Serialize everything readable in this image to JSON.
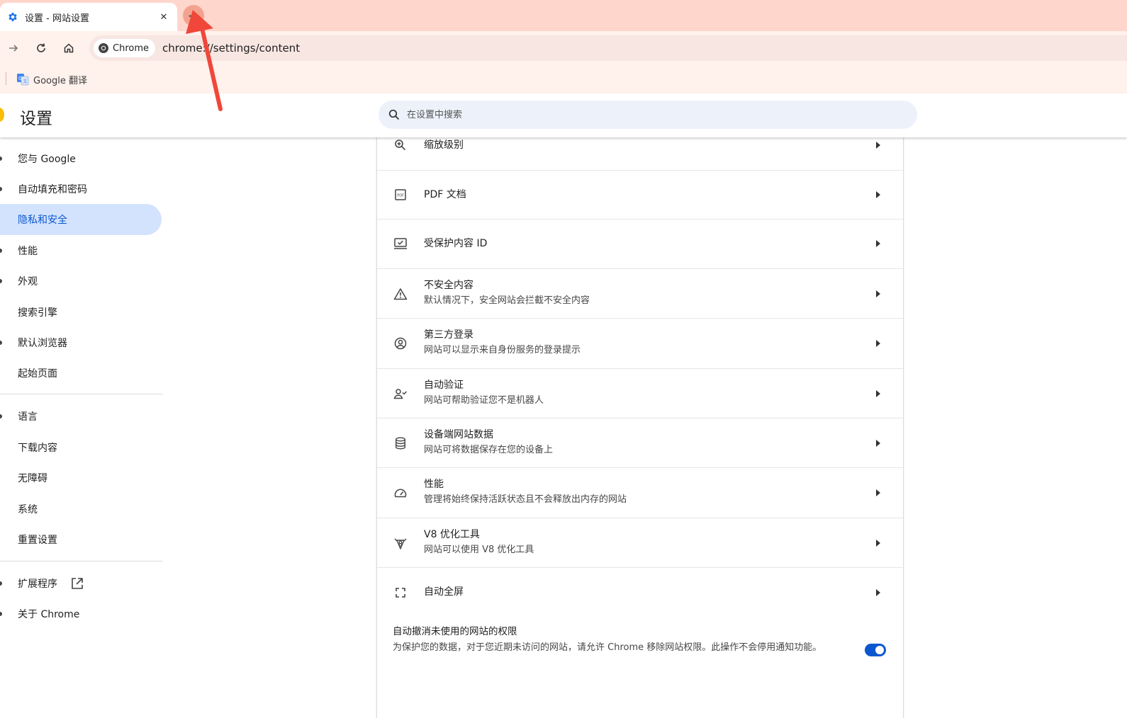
{
  "browser": {
    "tab": {
      "title": "设置 - 网站设置",
      "close": "✕"
    },
    "new_tab": "+",
    "omnibox": {
      "chip_label": "Chrome",
      "url": "chrome://settings/content"
    },
    "bookmarks": [
      {
        "label": "Google 翻译"
      }
    ]
  },
  "header": {
    "title": "设置",
    "search_placeholder": "在设置中搜索"
  },
  "sidebar": {
    "items": [
      {
        "label": "您与 Google",
        "active": false
      },
      {
        "label": "自动填充和密码",
        "active": false
      },
      {
        "label": "隐私和安全",
        "active": true
      },
      {
        "label": "性能",
        "active": false
      },
      {
        "label": "外观",
        "active": false
      },
      {
        "label": "搜索引擎",
        "active": false
      },
      {
        "label": "默认浏览器",
        "active": false
      },
      {
        "label": "起始页面",
        "active": false
      },
      {
        "label": "语言",
        "active": false
      },
      {
        "label": "下载内容",
        "active": false
      },
      {
        "label": "无障碍",
        "active": false
      },
      {
        "label": "系统",
        "active": false
      },
      {
        "label": "重置设置",
        "active": false
      },
      {
        "label": "扩展程序",
        "active": false
      },
      {
        "label": "关于 Chrome",
        "active": false
      }
    ]
  },
  "content": {
    "rows": [
      {
        "icon": "zoom-icon",
        "title": "缩放级别",
        "subtitle": ""
      },
      {
        "icon": "pdf-icon",
        "title": "PDF 文档",
        "subtitle": ""
      },
      {
        "icon": "protected-content-icon",
        "title": "受保护内容 ID",
        "subtitle": ""
      },
      {
        "icon": "warning-icon",
        "title": "不安全内容",
        "subtitle": "默认情况下，安全网站会拦截不安全内容"
      },
      {
        "icon": "account-icon",
        "title": "第三方登录",
        "subtitle": "网站可以显示来自身份服务的登录提示"
      },
      {
        "icon": "person-check-icon",
        "title": "自动验证",
        "subtitle": "网站可帮助验证您不是机器人"
      },
      {
        "icon": "database-icon",
        "title": "设备端网站数据",
        "subtitle": "网站可将数据保存在您的设备上"
      },
      {
        "icon": "speedometer-icon",
        "title": "性能",
        "subtitle": "管理将始终保持活跃状态且不会释放出内存的网站"
      },
      {
        "icon": "v8-icon",
        "title": "V8 优化工具",
        "subtitle": "网站可以使用 V8 优化工具"
      },
      {
        "icon": "fullscreen-icon",
        "title": "自动全屏",
        "subtitle": ""
      }
    ],
    "revoke": {
      "title": "自动撤消未使用的网站的权限",
      "description": "为保护您的数据，对于您近期未访问的网站，请允许 Chrome 移除网站权限。此操作不会停用通知功能。",
      "enabled": true
    }
  },
  "colors": {
    "tabstrip": "#ffd6cc",
    "toolbar": "#fff1ec",
    "accent": "#0b57d0",
    "active_nav_bg": "#d3e3fd",
    "annotation": "#f0473a"
  }
}
